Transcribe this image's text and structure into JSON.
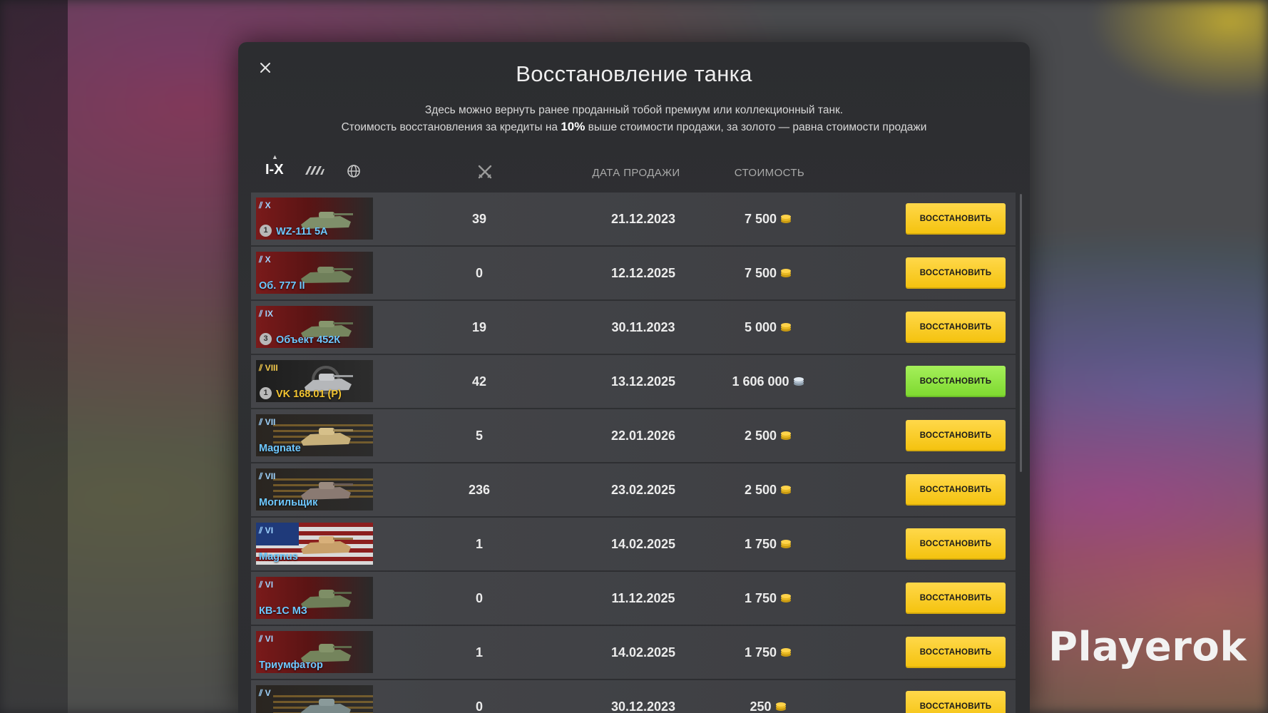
{
  "modal": {
    "title": "Восстановление танка",
    "desc_line1": "Здесь можно вернуть ранее проданный тобой премиум или коллекционный танк.",
    "desc_line2_a": "Стоимость восстановления за кредиты на ",
    "desc_line2_b": "10%",
    "desc_line2_c": " выше стоимости продажи, за золото — равна стоимости продажи"
  },
  "filters": {
    "tier_label": "I-X"
  },
  "columns": {
    "sale_date": "ДАТА ПРОДАЖИ",
    "cost": "СТОИМОСТЬ"
  },
  "restore_label": "ВОССТАНОВИТЬ",
  "rows": [
    {
      "tier": "X",
      "name": "WZ-111 5A",
      "mastery": "1",
      "battles": "39",
      "date": "21.12.2023",
      "cost": "7 500",
      "currency": "gold"
    },
    {
      "tier": "X",
      "name": "Об. 777 II",
      "mastery": "",
      "battles": "0",
      "date": "12.12.2025",
      "cost": "7 500",
      "currency": "gold"
    },
    {
      "tier": "IX",
      "name": "Объект 452К",
      "mastery": "3",
      "battles": "19",
      "date": "30.11.2023",
      "cost": "5 000",
      "currency": "gold"
    },
    {
      "tier": "VIII",
      "name": "VK 168.01 (P)",
      "mastery": "1",
      "battles": "42",
      "date": "13.12.2025",
      "cost": "1 606 000",
      "currency": "credits"
    },
    {
      "tier": "VII",
      "name": "Magnate",
      "mastery": "",
      "battles": "5",
      "date": "22.01.2026",
      "cost": "2 500",
      "currency": "gold"
    },
    {
      "tier": "VII",
      "name": "Могильщик",
      "mastery": "",
      "battles": "236",
      "date": "23.02.2025",
      "cost": "2 500",
      "currency": "gold"
    },
    {
      "tier": "VI",
      "name": "Magnus",
      "mastery": "",
      "battles": "1",
      "date": "14.02.2025",
      "cost": "1 750",
      "currency": "gold"
    },
    {
      "tier": "VI",
      "name": "КВ-1С МЗ",
      "mastery": "",
      "battles": "0",
      "date": "11.12.2025",
      "cost": "1 750",
      "currency": "gold"
    },
    {
      "tier": "VI",
      "name": "Триумфатор",
      "mastery": "",
      "battles": "1",
      "date": "14.02.2025",
      "cost": "1 750",
      "currency": "gold"
    },
    {
      "tier": "V",
      "name": "",
      "mastery": "",
      "battles": "0",
      "date": "30.12.2023",
      "cost": "250",
      "currency": "gold"
    }
  ],
  "watermark": "Playerok",
  "colors": {
    "button_gold": "#f4c20d",
    "button_green": "#7dd82f",
    "name_blue": "#6ec8ff",
    "name_gold": "#f2c431"
  }
}
